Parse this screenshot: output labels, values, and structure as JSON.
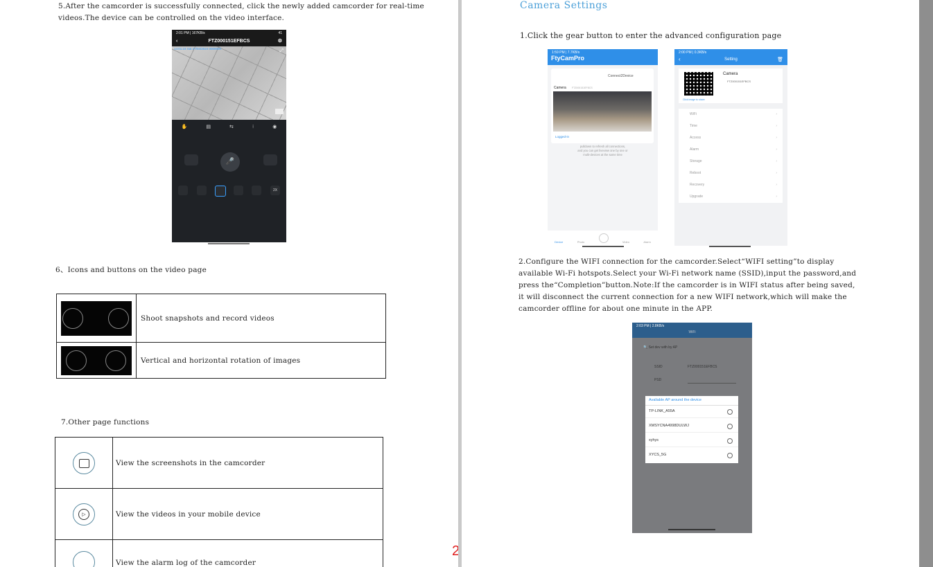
{
  "page_number": "2",
  "left": {
    "step5_line1": "5.After the camcorder is successfully connected, click the newly added camcorder for real-time",
    "step5_line2": "videos.The device can be controlled on the video interface.",
    "video_screen": {
      "status": "2:01 PM | 167KB/s",
      "battery": "41",
      "title": "FTZ000151EFBCS",
      "timestamp": "14:01:23  Sat 27/04/2024  0000000",
      "speed_label": "2X"
    },
    "section6_title": "6、Icons and buttons on the video page",
    "table6": [
      {
        "text": "Shoot snapshots and record videos"
      },
      {
        "text": "Vertical and horizontal rotation of images"
      }
    ],
    "section7_title": "7.Other page functions",
    "table7": [
      {
        "text": "View the screenshots in the camcorder"
      },
      {
        "text": "View the videos in your mobile device"
      },
      {
        "text": "View the alarm log of the camcorder"
      }
    ]
  },
  "right": {
    "title": "Camera  Settings",
    "step1": "1.Click the gear button to enter the advanced configuration page",
    "app_screen": {
      "status": "1:59 PM | 7.7KB/s",
      "app_name": "FtyCamPro",
      "connect_label": "Connect2Device",
      "camera_label": "Camera",
      "camera_id": "FTZ000151EFBCS",
      "logged_in": "Logged-in",
      "hint_line1": "pulldown to refresh all connections,",
      "hint_line2": "and you can get liveview one by one or",
      "hint_line3": "multi-devices at the same time",
      "nav": [
        "Device",
        "Photo",
        "Video",
        "Alarm"
      ]
    },
    "setting_screen": {
      "status": "2:00 PM | 0.3KB/s",
      "title": "Setting",
      "camera_label": "Camera",
      "camera_id": "FTZ000151EFBCS",
      "qr_hint": "Click image to share",
      "menu": [
        "WiFi",
        "Time",
        "Access",
        "Alarm",
        "Storage",
        "Reboot",
        "Recovery",
        "Upgrade"
      ]
    },
    "step2_lines": [
      "2.Configure the WIFI connection for the camcorder.Select“WIFI setting”to display",
      "available Wi-Fi hotspots.Select your Wi-Fi network name (SSID),input the password,and",
      "press the“Completion”button.Note:If the camcorder is in WIFI status after being saved,",
      "it will disconnect the current connection for a new WIFI network,which will make the",
      "camcorder offline for about one minute in the APP."
    ],
    "wifi_screen": {
      "status": "2:03 PM | 2.8KB/s",
      "title": "WiFi",
      "set_dev": "Set dev with by AP",
      "ssid_label": "SSID",
      "ssid_value": "FTZ000151EFBCS",
      "psd_label": "PSD",
      "available_title": "Avaliable AP around the device",
      "networks": [
        "TP-LINK_A55A",
        "XMSYCNA4998DULWJ",
        "xyhys",
        "XYCS_5G"
      ]
    }
  },
  "colors": {
    "heading_blue": "#4a9fd8",
    "app_blue": "#2f8fe8",
    "page_number_red": "#e02020"
  }
}
